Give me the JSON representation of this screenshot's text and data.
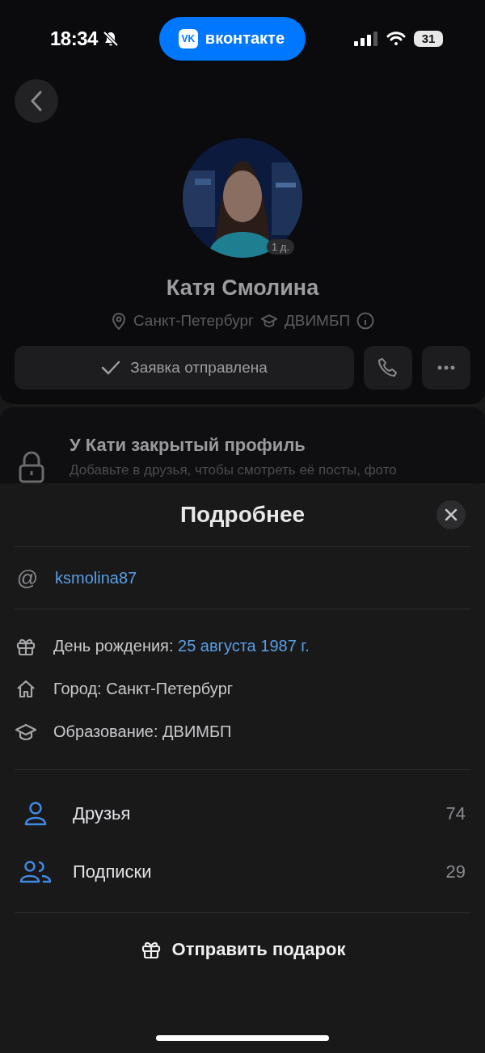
{
  "status_bar": {
    "time": "18:34",
    "app_logo": "VK",
    "app_label": "вконтакте",
    "battery": "31"
  },
  "profile": {
    "avatar_badge": "1 д.",
    "name": "Катя Смолина",
    "city": "Санкт-Петербург",
    "education": "ДВИМБП",
    "request_button": "Заявка отправлена"
  },
  "closed_notice": {
    "title": "У Кати закрытый профиль",
    "text": "Добавьте в друзья, чтобы смотреть её посты, фото"
  },
  "sheet": {
    "title": "Подробнее",
    "at_sign": "@",
    "username": "ksmolina87",
    "details": [
      {
        "kind": "birthday",
        "label": "День рождения: ",
        "value": "25 августа 1987 г."
      },
      {
        "kind": "city",
        "label": "Город: Санкт-Петербург"
      },
      {
        "kind": "education",
        "label": "Образование: ДВИМБП"
      }
    ],
    "counters": [
      {
        "kind": "friends",
        "label": "Друзья",
        "count": "74"
      },
      {
        "kind": "subscriptions",
        "label": "Подписки",
        "count": "29"
      }
    ],
    "gift_button": "Отправить подарок"
  }
}
